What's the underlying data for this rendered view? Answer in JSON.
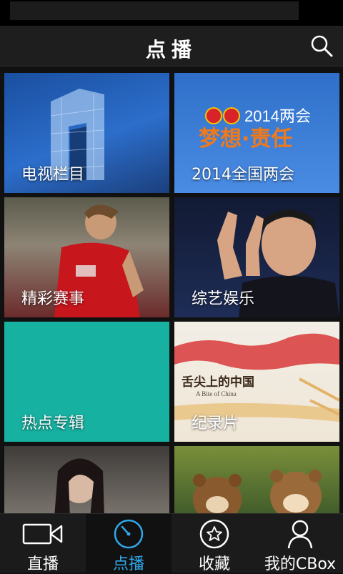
{
  "header": {
    "title": "点播"
  },
  "tiles": [
    {
      "label": "电视栏目"
    },
    {
      "label": "2014全国两会",
      "art_text_top": "2014两会",
      "art_text_main": "梦想·责任"
    },
    {
      "label": "精彩赛事"
    },
    {
      "label": "综艺娱乐"
    },
    {
      "label": "热点专辑"
    },
    {
      "label": "纪录片",
      "art_text_title": "舌尖上的中国",
      "art_text_sub": "A Bite of China"
    },
    {
      "label": ""
    },
    {
      "label": ""
    }
  ],
  "tabs": [
    {
      "label": "直播",
      "icon": "video-camera-icon"
    },
    {
      "label": "点播",
      "icon": "dial-icon",
      "active": true
    },
    {
      "label": "收藏",
      "icon": "star-icon"
    },
    {
      "label": "我的CBox",
      "icon": "person-icon"
    }
  ],
  "colors": {
    "accent": "#2fa8ea",
    "teal": "#17b1a1",
    "bar": "#1b1b1b"
  }
}
